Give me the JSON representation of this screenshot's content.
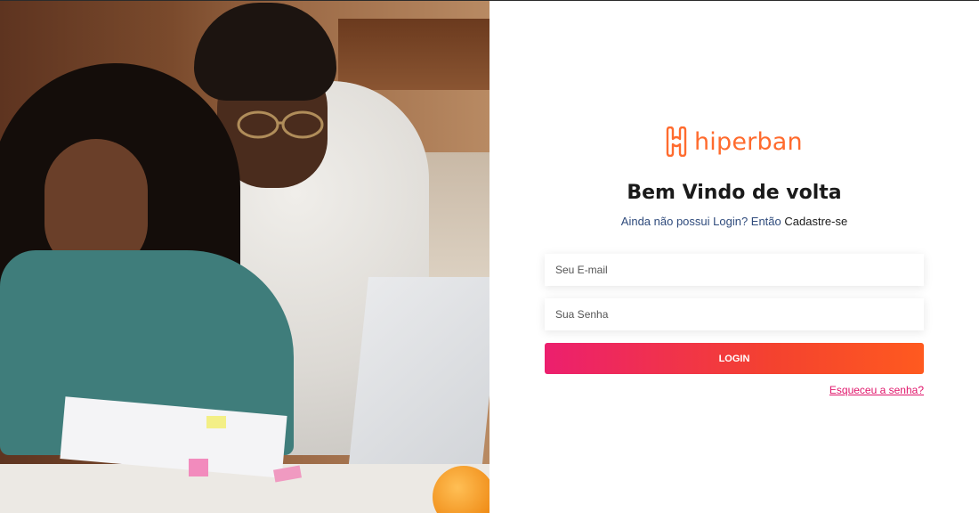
{
  "brand": {
    "name": "hiperban",
    "color": "#ff6b2e"
  },
  "welcome": {
    "title": "Bem Vindo de volta",
    "prompt": "Ainda não possui Login? Então",
    "signup_link": "Cadastre-se"
  },
  "form": {
    "email_placeholder": "Seu E-mail",
    "password_placeholder": "Sua Senha",
    "login_label": "LOGIN",
    "forgot_link": "Esqueceu a senha?"
  },
  "colors": {
    "accent_start": "#ec1f6e",
    "accent_end": "#ff5a1f",
    "link_pink": "#e0156a",
    "subtitle_blue": "#2f4b7c"
  }
}
